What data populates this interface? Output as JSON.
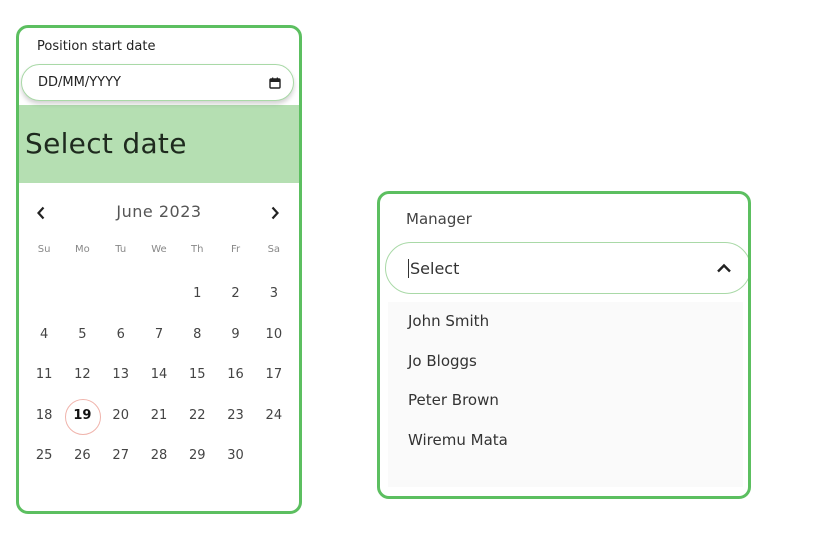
{
  "date_picker": {
    "label": "Position start date",
    "input_placeholder": "DD/MM/YYYY",
    "header_title": "Select date",
    "month": "June",
    "year": "2023",
    "month_year": "June 2023",
    "prev_label": "‹",
    "next_label": "›",
    "weekdays": [
      "Su",
      "Mo",
      "Tu",
      "We",
      "Th",
      "Fr",
      "Sa"
    ],
    "weeks": [
      [
        "",
        "",
        "",
        "",
        "1",
        "2",
        "3"
      ],
      [
        "4",
        "5",
        "6",
        "7",
        "8",
        "9",
        "10"
      ],
      [
        "11",
        "12",
        "13",
        "14",
        "15",
        "16",
        "17"
      ],
      [
        "18",
        "19",
        "20",
        "21",
        "22",
        "23",
        "24"
      ],
      [
        "25",
        "26",
        "27",
        "28",
        "29",
        "30",
        ""
      ]
    ],
    "today": "19"
  },
  "manager_select": {
    "label": "Manager",
    "value": "Select",
    "expanded": true,
    "options": [
      "John Smith",
      "Jo Bloggs",
      "Peter Brown",
      "Wiremu Mata"
    ]
  },
  "colors": {
    "accent_border": "#5cbf60",
    "header_fill": "#b5dfb2",
    "today_ring": "#f0b4ac"
  }
}
